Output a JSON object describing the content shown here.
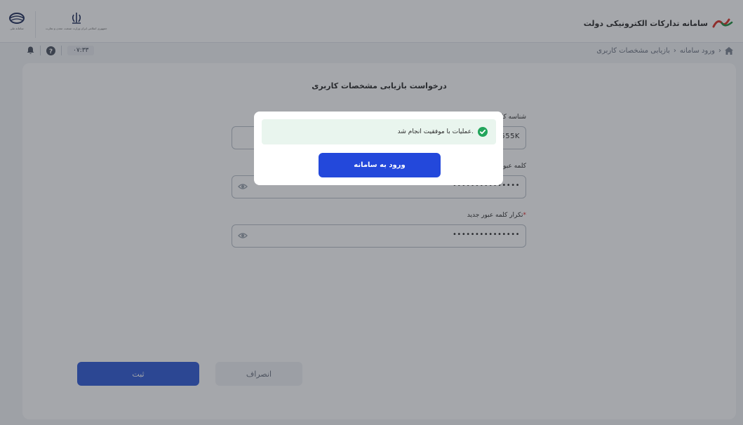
{
  "header": {
    "brand_title": "سامانه تدارکات الکترونیکی دولت",
    "logo_left_caption": "سامانه ملی",
    "logo_right_caption": "جمهوری اسلامی ایران وزارت صنعت، معدن و تجارت"
  },
  "breadcrumb": {
    "home_icon": "home-icon",
    "items": [
      "ورود سامانه",
      "بازیابی مشخصات کاربری"
    ]
  },
  "toolbar": {
    "time": "۰۷:۳۳"
  },
  "form": {
    "title": "درخواست بازیابی مشخصات کاربری",
    "fields": [
      {
        "label": "شناسه کاربری",
        "value": "1555K",
        "required": false
      },
      {
        "label": "کلمه عبور جدید",
        "value": "•••••••••••••••",
        "required": false
      },
      {
        "label": "تکرار کلمه عبور جدید",
        "value": "•••••••••••••••",
        "required": true
      }
    ],
    "submit_label": "ثبت",
    "cancel_label": "انصراف"
  },
  "modal": {
    "message": "عملیات با موفقیت انجام شد.",
    "button_label": "ورود به سامانه"
  },
  "colors": {
    "primary": "#2348db",
    "success": "#22a55b",
    "required": "#dc2626"
  }
}
